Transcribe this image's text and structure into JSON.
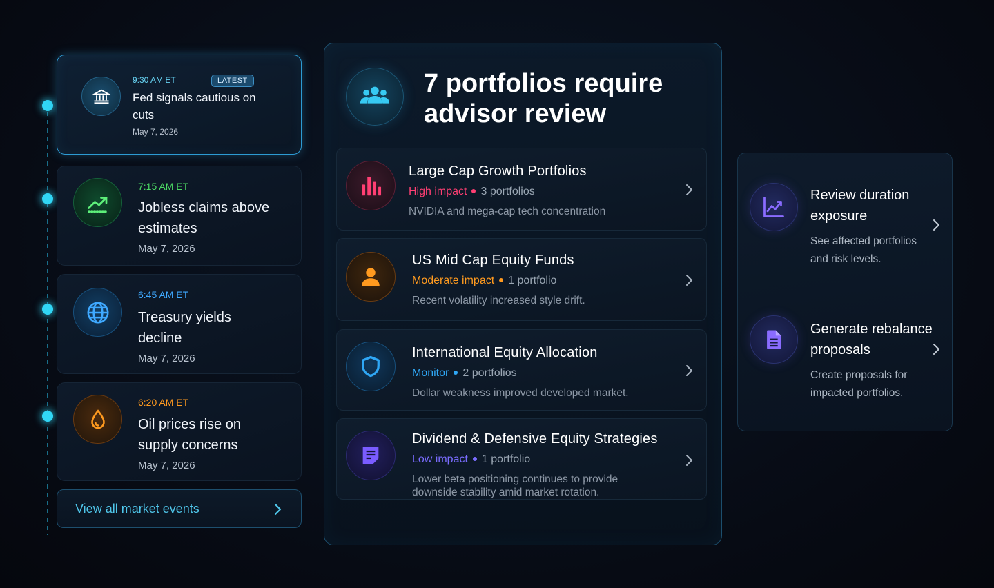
{
  "colors": {
    "accent_cyan": "#31d6f5",
    "high_impact": "#ff3f73",
    "moderate_impact": "#ff9a1f",
    "monitor": "#2fa7f5",
    "low_impact": "#8a6cff",
    "event_green": "#4cd964",
    "event_orange": "#ff9a1f"
  },
  "events": [
    {
      "time": "9:30 AM ET",
      "badge": "LATEST",
      "title": "Fed signals cautious on cuts",
      "date": "May 7, 2026",
      "icon": "bank-icon"
    },
    {
      "time": "7:15 AM ET",
      "title": "Jobless claims above estimates",
      "date": "May 7, 2026",
      "icon": "trending-up-icon"
    },
    {
      "time": "6:45 AM ET",
      "title": "Treasury yields decline",
      "date": "May 7, 2026",
      "icon": "globe-icon"
    },
    {
      "time": "6:20 AM ET",
      "title": "Oil prices rise on supply concerns",
      "date": "May 7, 2026",
      "icon": "oil-drop-icon"
    }
  ],
  "view_all_label": "View all market events",
  "review": {
    "title": "7 portfolios require advisor review",
    "icon": "users-group-icon",
    "items": [
      {
        "name": "Large Cap Growth Portfolios",
        "impact": "High impact",
        "count": "3 portfolios",
        "desc": "NVIDIA and mega-cap tech concentration",
        "icon": "bar-chart-icon"
      },
      {
        "name": "US Mid Cap Equity Funds",
        "impact": "Moderate impact",
        "count": "1 portfolio",
        "desc": "Recent volatility increased style drift.",
        "icon": "person-icon"
      },
      {
        "name": "International Equity Allocation",
        "impact": "Monitor",
        "count": "2 portfolios",
        "desc": "Dollar weakness improved developed market.",
        "icon": "shield-icon"
      },
      {
        "name": "Dividend & Defensive Equity Strategies",
        "impact": "Low impact",
        "count": "1 portfolio",
        "desc": "Lower beta positioning continues to provide downside stability amid market rotation.",
        "icon": "document-icon"
      }
    ]
  },
  "actions": [
    {
      "title": "Review duration exposure",
      "desc": "See affected portfolios and risk levels.",
      "icon": "line-chart-icon"
    },
    {
      "title": "Generate rebalance proposals",
      "desc": "Create proposals for impacted portfolios.",
      "icon": "file-text-icon"
    }
  ]
}
